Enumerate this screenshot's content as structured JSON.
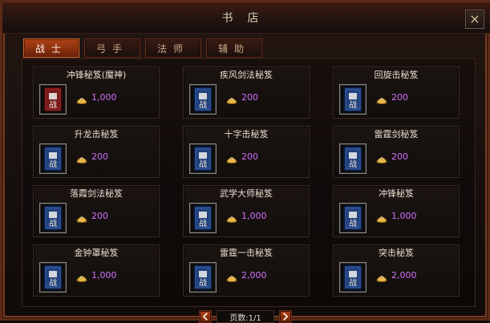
{
  "window": {
    "title": "书店",
    "close_glyph": "×"
  },
  "tabs": [
    {
      "label": "战士",
      "active": true
    },
    {
      "label": "弓手",
      "active": false
    },
    {
      "label": "法师",
      "active": false
    },
    {
      "label": "辅助",
      "active": false
    }
  ],
  "items": [
    {
      "name": "冲锋秘笈(魔神)",
      "price": "1,000",
      "icon": "red-book-icon"
    },
    {
      "name": "疾风剑法秘笈",
      "price": "200",
      "icon": "blue-book-icon"
    },
    {
      "name": "回旋击秘笈",
      "price": "200",
      "icon": "blue-book-icon"
    },
    {
      "name": "升龙击秘笈",
      "price": "200",
      "icon": "blue-book-icon"
    },
    {
      "name": "十字击秘笈",
      "price": "200",
      "icon": "blue-book-icon"
    },
    {
      "name": "雷霆剑秘笈",
      "price": "200",
      "icon": "blue-book-icon"
    },
    {
      "name": "落霞剑法秘笈",
      "price": "200",
      "icon": "blue-book-icon"
    },
    {
      "name": "武学大师秘笈",
      "price": "1,000",
      "icon": "blue-book-icon"
    },
    {
      "name": "冲锋秘笈",
      "price": "1,000",
      "icon": "blue-book-icon"
    },
    {
      "name": "金钟罩秘笈",
      "price": "1,000",
      "icon": "blue-book-icon"
    },
    {
      "name": "雷霆一击秘笈",
      "price": "2,000",
      "icon": "blue-book-icon"
    },
    {
      "name": "突击秘笈",
      "price": "2,000",
      "icon": "blue-book-icon"
    }
  ],
  "book_tag": "战",
  "pagination": {
    "text": "页数:1/1"
  },
  "colors": {
    "active_tab": "#b04216",
    "price": "#d070ff",
    "gold": "#e6b84a",
    "blue_book": "#2a4d8f",
    "red_book": "#8b1f1f"
  }
}
